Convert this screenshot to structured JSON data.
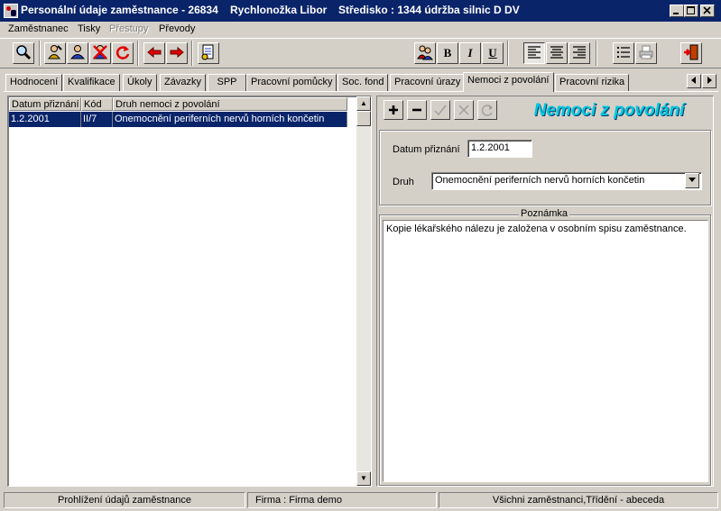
{
  "window": {
    "title": "Personální údaje zaměstnance - 26834",
    "employee": "Rychlonožka Libor",
    "center": "Středisko : 1344 údržba silnic   D DV"
  },
  "menu": [
    {
      "label": "Zaměstnanec",
      "disabled": false
    },
    {
      "label": "Tisky",
      "disabled": false
    },
    {
      "label": "Přestupy",
      "disabled": true
    },
    {
      "label": "Převody",
      "disabled": false
    }
  ],
  "toolbar": {
    "bold_label": "B",
    "italic_label": "I",
    "underline_label": "U"
  },
  "tabs": [
    "Hodnocení",
    "Kvalifikace",
    "Úkoly",
    "Závazky",
    "SPP",
    "Pracovní pomůcky",
    "Soc. fond",
    "Pracovní úrazy",
    "Nemoci z povolání",
    "Pracovní rizika"
  ],
  "active_tab": "Nemoci z povolání",
  "grid": {
    "columns": [
      "Datum přiznání",
      "Kód",
      "Druh nemoci z povolání"
    ],
    "rows": [
      [
        "1.2.2001",
        "II/7",
        "Onemocnění periferních nervů horních končetin"
      ]
    ]
  },
  "detail": {
    "heading": "Nemoci z povolání",
    "date_label": "Datum přiznání",
    "date_value": "1.2.2001",
    "type_label": "Druh",
    "type_value": "Onemocnění periferních nervů horních končetin",
    "note_label": "Poznámka",
    "note_value": "Kopie lékařského nálezu je založena v osobním spisu zaměstnance."
  },
  "statusbar": {
    "mode": "Prohlížení údajů zaměstnance",
    "company": "Firma :  Firma demo",
    "filter": "Všichni zaměstnanci,Třídění - abeceda"
  },
  "colors": {
    "titlebar": "#0a246a",
    "selection": "#0a246a",
    "heading": "#00c8e0",
    "face": "#d4d0c8"
  }
}
